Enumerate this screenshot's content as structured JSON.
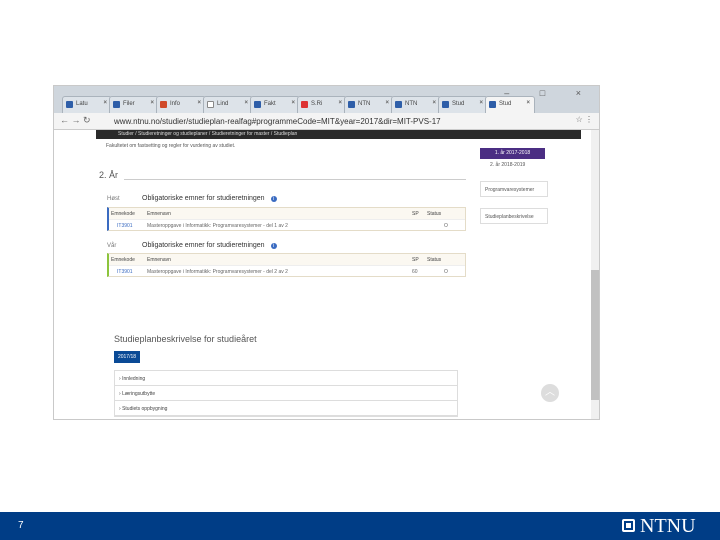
{
  "browser": {
    "tabs": [
      "Latu",
      "Filer",
      "Info",
      "Lind",
      "Fakt",
      "S.Ri",
      "NTN",
      "NTN",
      "Stud",
      "Stud"
    ],
    "url": "www.ntnu.no/studier/studieplan-realfag#programmeCode=MIT&year=2017&dir=MIT-PVS-17",
    "window_controls": "– □ ×"
  },
  "page": {
    "breadcrumb": "Studier / Studieretninger og studieplaner / Studieretninger for master / Studieplan",
    "faculty_text": "Fakultetet om fastsetting og regler for vurdering av studiet.",
    "years": [
      "1. år 2017-2018",
      "2. år 2018-2019"
    ],
    "side_links": [
      "Programvaresystemer",
      "Studieplanbeskrivelse"
    ],
    "year_heading": "2. År",
    "sections": [
      {
        "semester": "Høst",
        "title": "Obligatoriske emner for studieretningen",
        "headers": [
          "Emnekode",
          "Emnenavn",
          "SP",
          "Status"
        ],
        "rows": [
          {
            "code": "IT3901",
            "name": "Masteroppgave i Informatikk: Programvaresystemer - del 1 av 2",
            "sp": "",
            "status": "O"
          }
        ]
      },
      {
        "semester": "Vår",
        "title": "Obligatoriske emner for studieretningen",
        "headers": [
          "Emnekode",
          "Emnenavn",
          "SP",
          "Status"
        ],
        "rows": [
          {
            "code": "IT3901",
            "name": "Masteroppgave i Informatikk: Programvaresystemer - del 2 av 2",
            "sp": "60",
            "status": "O"
          }
        ]
      }
    ],
    "desc_heading": "Studieplanbeskrivelse for studieåret",
    "year_button": "2017/18",
    "accordion": [
      "Innledning",
      "Læringsutbytte",
      "Studiets oppbygning"
    ]
  },
  "slide": {
    "page_number": "7",
    "logo_text": "NTNU"
  },
  "colors": {
    "footer": "#003d86",
    "purple": "#4b2e83",
    "button": "#0a4a96"
  }
}
